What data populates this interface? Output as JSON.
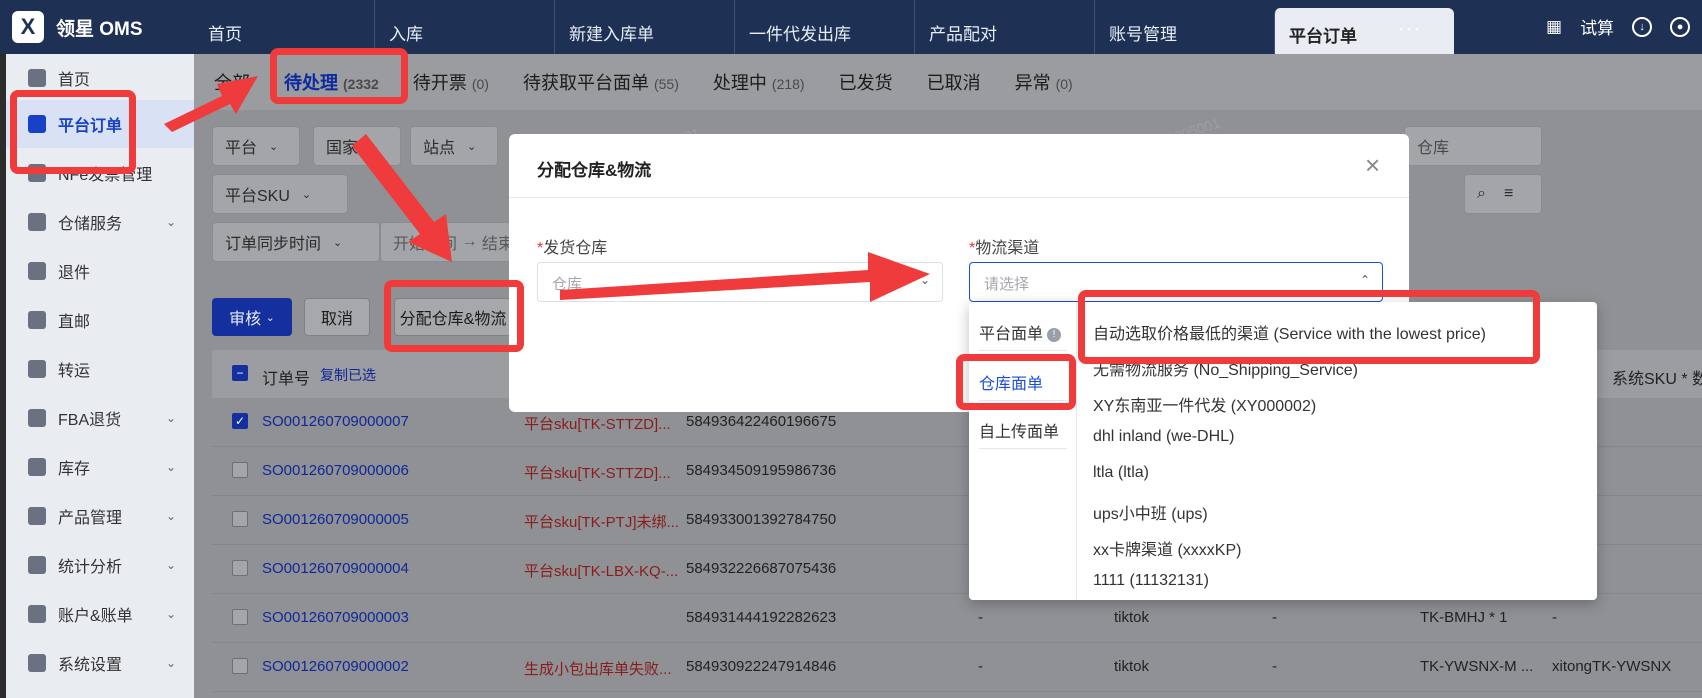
{
  "app": {
    "logo_mark": "X",
    "logo_text": "领星 OMS"
  },
  "top_tabs": [
    "首页",
    "入库",
    "新建入库单",
    "一件代发出库",
    "产品配对",
    "账号管理",
    "平台订单"
  ],
  "top_more": "···",
  "top_right": {
    "trial_label": "试算"
  },
  "sidebar": [
    {
      "label": "首页"
    },
    {
      "label": "平台订单"
    },
    {
      "label": "NFe发票管理"
    },
    {
      "label": "仓储服务",
      "chevron": "⌄"
    },
    {
      "label": "退件"
    },
    {
      "label": "直邮"
    },
    {
      "label": "转运"
    },
    {
      "label": "FBA退货",
      "chevron": "⌄"
    },
    {
      "label": "库存",
      "chevron": "⌄"
    },
    {
      "label": "产品管理",
      "chevron": "⌄"
    },
    {
      "label": "统计分析",
      "chevron": "⌄"
    },
    {
      "label": "账户&账单",
      "chevron": "⌄"
    },
    {
      "label": "系统设置",
      "chevron": "⌄"
    }
  ],
  "status_tabs": [
    {
      "label": "全部",
      "count": ""
    },
    {
      "label": "待处理",
      "count": "(2332"
    },
    {
      "label": "待开票",
      "count": "(0)"
    },
    {
      "label": "待获取平台面单",
      "count": "(55)"
    },
    {
      "label": "处理中",
      "count": "(218)"
    },
    {
      "label": "已发货",
      "count": ""
    },
    {
      "label": "已取消",
      "count": ""
    },
    {
      "label": "异常",
      "count": "(0)"
    }
  ],
  "filters": {
    "platform": "平台",
    "country": "国家",
    "site": "站点",
    "warehouse_placeholder": "仓库",
    "platform_sku": "平台SKU",
    "sync_time": "订单同步时间",
    "range_start": "开始时间",
    "range_sep": "→",
    "range_end": "结束"
  },
  "actions": {
    "review": "审核",
    "cancel": "取消",
    "assign": "分配仓库&物流"
  },
  "table": {
    "headers": {
      "order_no": "订单号",
      "copy_selected": "复制已选",
      "sys_sku": "系统SKU * 数量"
    },
    "rows": [
      {
        "order": "SO001260709000007",
        "note": "平台sku[TK-STTZD]...",
        "track": "584936422460196675",
        "checked": true,
        "extra": "",
        "platform": "",
        "sku": "",
        "sys": ""
      },
      {
        "order": "SO001260709000006",
        "note": "平台sku[TK-STTZD]...",
        "track": "584934509195986736",
        "checked": false,
        "extra": "",
        "platform": "",
        "sku": "",
        "sys": ""
      },
      {
        "order": "SO001260709000005",
        "note": "平台sku[TK-PTJ]未绑...",
        "track": "584933001392784750",
        "checked": false,
        "extra": "",
        "platform": "",
        "sku": "",
        "sys": ""
      },
      {
        "order": "SO001260709000004",
        "note": "平台sku[TK-LBX-KQ-...",
        "track": "584932226687075436",
        "checked": false,
        "extra": "",
        "platform": "",
        "sku": "",
        "sys": ""
      },
      {
        "order": "SO001260709000003",
        "note": "",
        "track": "584931444192282623",
        "checked": false,
        "extra": "-",
        "platform": "tiktok",
        "dash": "-",
        "sku": "TK-BMHJ * 1",
        "sys": "-"
      },
      {
        "order": "SO001260709000002",
        "note": "生成小包出库单失败...",
        "track": "584930922247914846",
        "checked": false,
        "extra": "-",
        "platform": "tiktok",
        "dash": "-",
        "sku": "TK-YWSNX-M ...",
        "sys": "xitongTK-YWSNX"
      }
    ]
  },
  "watermark": "ak001-001_1005001",
  "modal": {
    "title": "分配仓库&物流",
    "close": "×",
    "warehouse_label": "发货仓库",
    "warehouse_placeholder": "仓库",
    "logistics_label": "物流渠道",
    "logistics_placeholder": "请选择",
    "required_mark": "*"
  },
  "dropdown": {
    "categories": [
      "平台面单",
      "仓库面单",
      "自上传面单"
    ],
    "active_category": "仓库面单",
    "options": [
      "自动选取价格最低的渠道 (Service with the lowest price)",
      "无需物流服务 (No_Shipping_Service)",
      "XY东南亚一件代发 (XY000002)",
      "dhl inland (we-DHL)",
      "ltla (ltla)",
      "ups小中班 (ups)",
      "xx卡牌渠道 (xxxxKP)",
      "1111 (11132131)"
    ]
  },
  "colors": {
    "primary": "#1d4ed8",
    "nav": "#1e3154",
    "annotation": "#ef3b3b"
  }
}
